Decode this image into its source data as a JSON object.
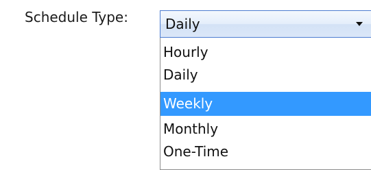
{
  "schedule": {
    "label": "Schedule Type:",
    "selected_value": "Daily",
    "highlighted_option": "Weekly",
    "options": [
      "Hourly",
      "Daily",
      "Weekly",
      "Monthly",
      "One-Time"
    ]
  },
  "colors": {
    "highlight": "#3399ff",
    "dropdown_border": "#4b7bd0"
  },
  "icons": {
    "dropdown_arrow": "chevron-down-icon"
  }
}
